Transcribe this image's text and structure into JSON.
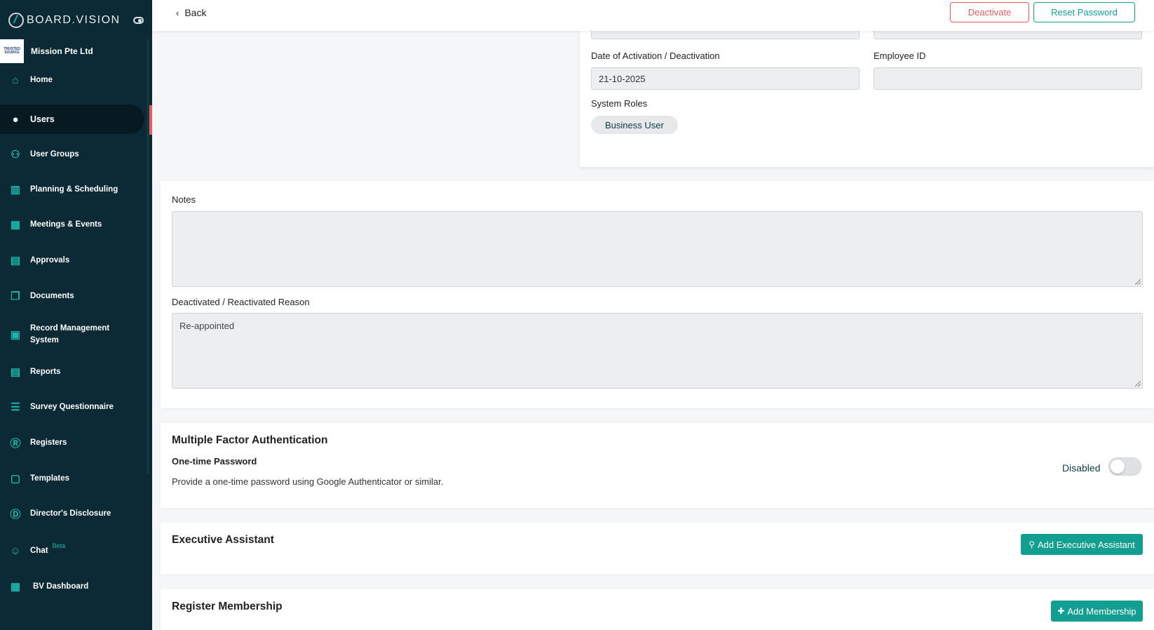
{
  "sidebar": {
    "brand": "BOARD.VISION",
    "organization": "Mission Pte Ltd",
    "org_logo_text": "TRUSTED SOURCE",
    "items": [
      {
        "label": "Home",
        "icon": "home-icon",
        "glyph": "⌂"
      },
      {
        "label": "Users",
        "icon": "user-icon",
        "glyph": "●"
      },
      {
        "label": "User Groups",
        "icon": "user-groups-icon",
        "glyph": "⚇"
      },
      {
        "label": "Planning & Scheduling",
        "icon": "planning-icon",
        "glyph": "▥"
      },
      {
        "label": "Meetings & Events",
        "icon": "calendar-icon",
        "glyph": "▦"
      },
      {
        "label": "Approvals",
        "icon": "approvals-icon",
        "glyph": "▤"
      },
      {
        "label": "Documents",
        "icon": "documents-icon",
        "glyph": "❐"
      },
      {
        "label": "Record Management System",
        "icon": "records-icon",
        "glyph": "▣"
      },
      {
        "label": "Reports",
        "icon": "reports-icon",
        "glyph": "▤"
      },
      {
        "label": "Survey Questionnaire",
        "icon": "survey-icon",
        "glyph": "☰"
      },
      {
        "label": "Registers",
        "icon": "registers-icon",
        "glyph": "Ⓡ"
      },
      {
        "label": "Templates",
        "icon": "templates-icon",
        "glyph": "▢"
      },
      {
        "label": "Director's Disclosure",
        "icon": "disclosure-icon",
        "glyph": "Ⓓ"
      },
      {
        "label": "Chat",
        "icon": "chat-icon",
        "glyph": "☺",
        "badge": "Beta"
      },
      {
        "label": "BV Dashboard",
        "icon": "dashboard-icon",
        "glyph": "▦"
      }
    ]
  },
  "topbar": {
    "back_label": "Back",
    "deactivate_label": "Deactivate",
    "reset_password_label": "Reset Password"
  },
  "user_details": {
    "date_label": "Date of Activation / Deactivation",
    "date_value": "21-10-2025",
    "employee_id_label": "Employee ID",
    "employee_id_value": "",
    "system_roles_label": "System Roles",
    "system_role": "Business User"
  },
  "notes": {
    "notes_label": "Notes",
    "notes_value": "",
    "reason_label": "Deactivated / Reactivated Reason",
    "reason_value": "Re-appointed"
  },
  "mfa": {
    "title": "Multiple Factor Authentication",
    "otp_title": "One-time Password",
    "otp_desc": "Provide a one-time password using Google Authenticator or similar.",
    "status": "Disabled",
    "enabled": false
  },
  "executive_assistant": {
    "title": "Executive Assistant",
    "add_label": "Add Executive Assistant"
  },
  "register_membership": {
    "title": "Register Membership",
    "add_label": "Add Membership"
  },
  "colors": {
    "sidebar_bg": "#0c2a35",
    "accent_teal": "#139e92",
    "danger": "#e35d5d"
  }
}
